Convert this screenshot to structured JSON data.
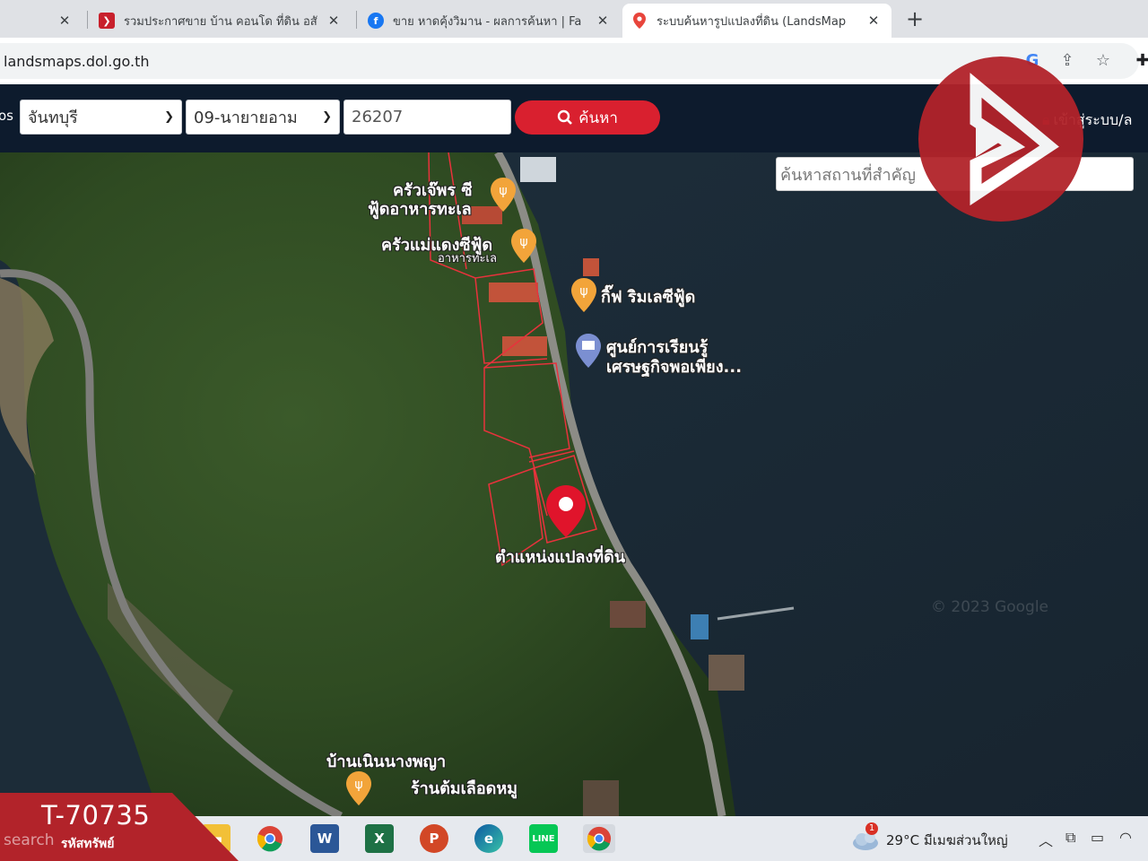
{
  "browser": {
    "tabs": [
      {
        "title": "",
        "favicon": "blank-icon"
      },
      {
        "title": "รวมประกาศขาย บ้าน คอนโด ที่ดิน อสั",
        "favicon": "brand-b-icon"
      },
      {
        "title": "ขาย หาดคุ้งวิมาน - ผลการค้นหา | Fa",
        "favicon": "facebook-icon"
      },
      {
        "title": "ระบบค้นหารูปแปลงที่ดิน (LandsMap",
        "favicon": "map-pin-icon",
        "active": true
      }
    ],
    "new_tab_label": "+",
    "url": "landsmaps.dol.go.th"
  },
  "site": {
    "lead_text": "os",
    "province": "จันทบุรี",
    "district": "09-นายายอาม",
    "parcel_no": "26207",
    "search_label": "ค้นหา",
    "login_label": "เข้าสู่ระบบ/ล"
  },
  "map": {
    "place_search_placeholder": "ค้นหาสถานที่สำคัญ",
    "pois": [
      {
        "name": "ครัวเจ๊พร ซี",
        "sub": "ฟู้ดอาหารทะเล",
        "icon": "restaurant-icon"
      },
      {
        "name": "ครัวแม่แดงซีฟู้ด",
        "sub": "อาหารทะเล",
        "icon": "restaurant-icon"
      },
      {
        "name": "กิ๊ฟ ริมเลซีฟู้ด",
        "icon": "restaurant-icon"
      },
      {
        "name": "ศูนย์การเรียนรู้",
        "sub": "เศรษฐกิจพอเพียง...",
        "icon": "learning-center-icon"
      },
      {
        "name": "บ้านเนินนางพญา",
        "icon": "village-label"
      },
      {
        "name": "ร้านต้มเลือดหมู",
        "icon": "restaurant-icon"
      }
    ],
    "parcel_label": "ตำแหน่งแปลงที่ดิน",
    "copyright": "© 2023 Google"
  },
  "overlay": {
    "code": "T-70735",
    "code_label": "รหัสทรัพย์",
    "search_word": "search"
  },
  "taskbar": {
    "apps": [
      "file-explorer-icon",
      "chrome-icon",
      "word-icon",
      "excel-icon",
      "powerpoint-icon",
      "edge-icon",
      "line-icon",
      "chrome-active-icon"
    ],
    "weather": "29°C  มีเมฆส่วนใหญ่",
    "weather_badge": "1"
  },
  "colors": {
    "brand_red": "#d9202f",
    "header_navy": "#0d1b2d",
    "watermark_red": "#b2232a",
    "parcel_line": "#e8323c"
  }
}
